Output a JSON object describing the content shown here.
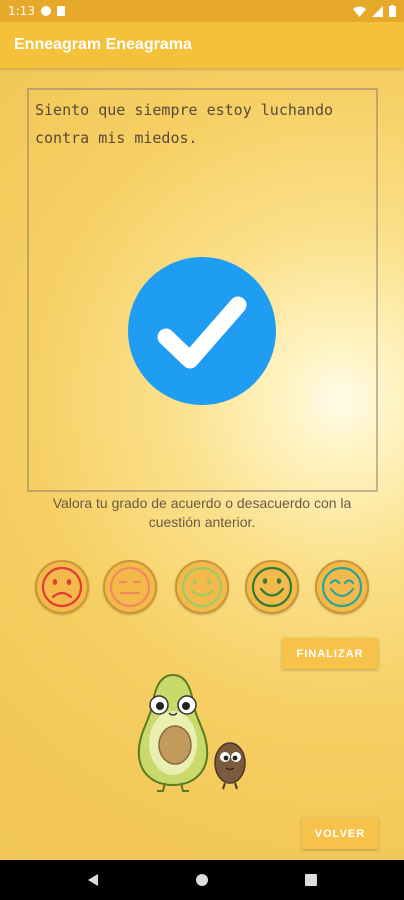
{
  "status_bar": {
    "time": "1:13"
  },
  "app_bar": {
    "title": "Enneagram Eneagrama"
  },
  "question": {
    "text": "Siento que siempre estoy luchando contra mis miedos."
  },
  "check_icon": "checkmark-circle-icon",
  "prompt": {
    "text": "Valora tu grado de acuerdo o desacuerdo con la cuestión anterior."
  },
  "rating_options": [
    {
      "icon": "sad-face-icon",
      "color": "#e53935"
    },
    {
      "icon": "neutral-face-icon",
      "color": "#f08a5d"
    },
    {
      "icon": "slight-smile-face-icon",
      "color": "#9ccc65"
    },
    {
      "icon": "smile-face-icon",
      "color": "#43a047"
    },
    {
      "icon": "happy-face-icon",
      "color": "#26a69a"
    }
  ],
  "buttons": {
    "finish_label": "FINALIZAR",
    "back_label": "VOLVER"
  },
  "colors": {
    "app_bar": "#f4c23a",
    "status_bar": "#e7a92a",
    "button": "#f6c24a",
    "check": "#1e9df2"
  },
  "nav_bar": {
    "icons": [
      "back-triangle-icon",
      "home-circle-icon",
      "recents-square-icon"
    ]
  }
}
